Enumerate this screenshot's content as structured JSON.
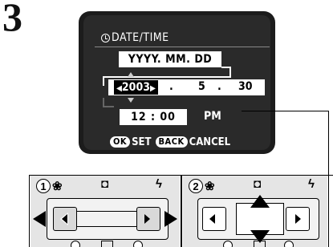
{
  "step": {
    "number": "3"
  },
  "lcd": {
    "title": "DATE/TIME",
    "format": "YYYY. MM. DD",
    "date": {
      "year": "2003",
      "sep1": ".",
      "month": "5",
      "sep2": ".",
      "day": "30"
    },
    "time": "12 : 00",
    "ampm": "PM",
    "footer": {
      "ok_key": "OK",
      "ok_label": "SET",
      "back_key": "BACK",
      "back_label": "CANCEL"
    }
  },
  "controls": {
    "step1": "1",
    "step2": "2",
    "icons": [
      "macro-icon",
      "self-timer-icon",
      "flash-icon",
      "battery-icon"
    ]
  }
}
